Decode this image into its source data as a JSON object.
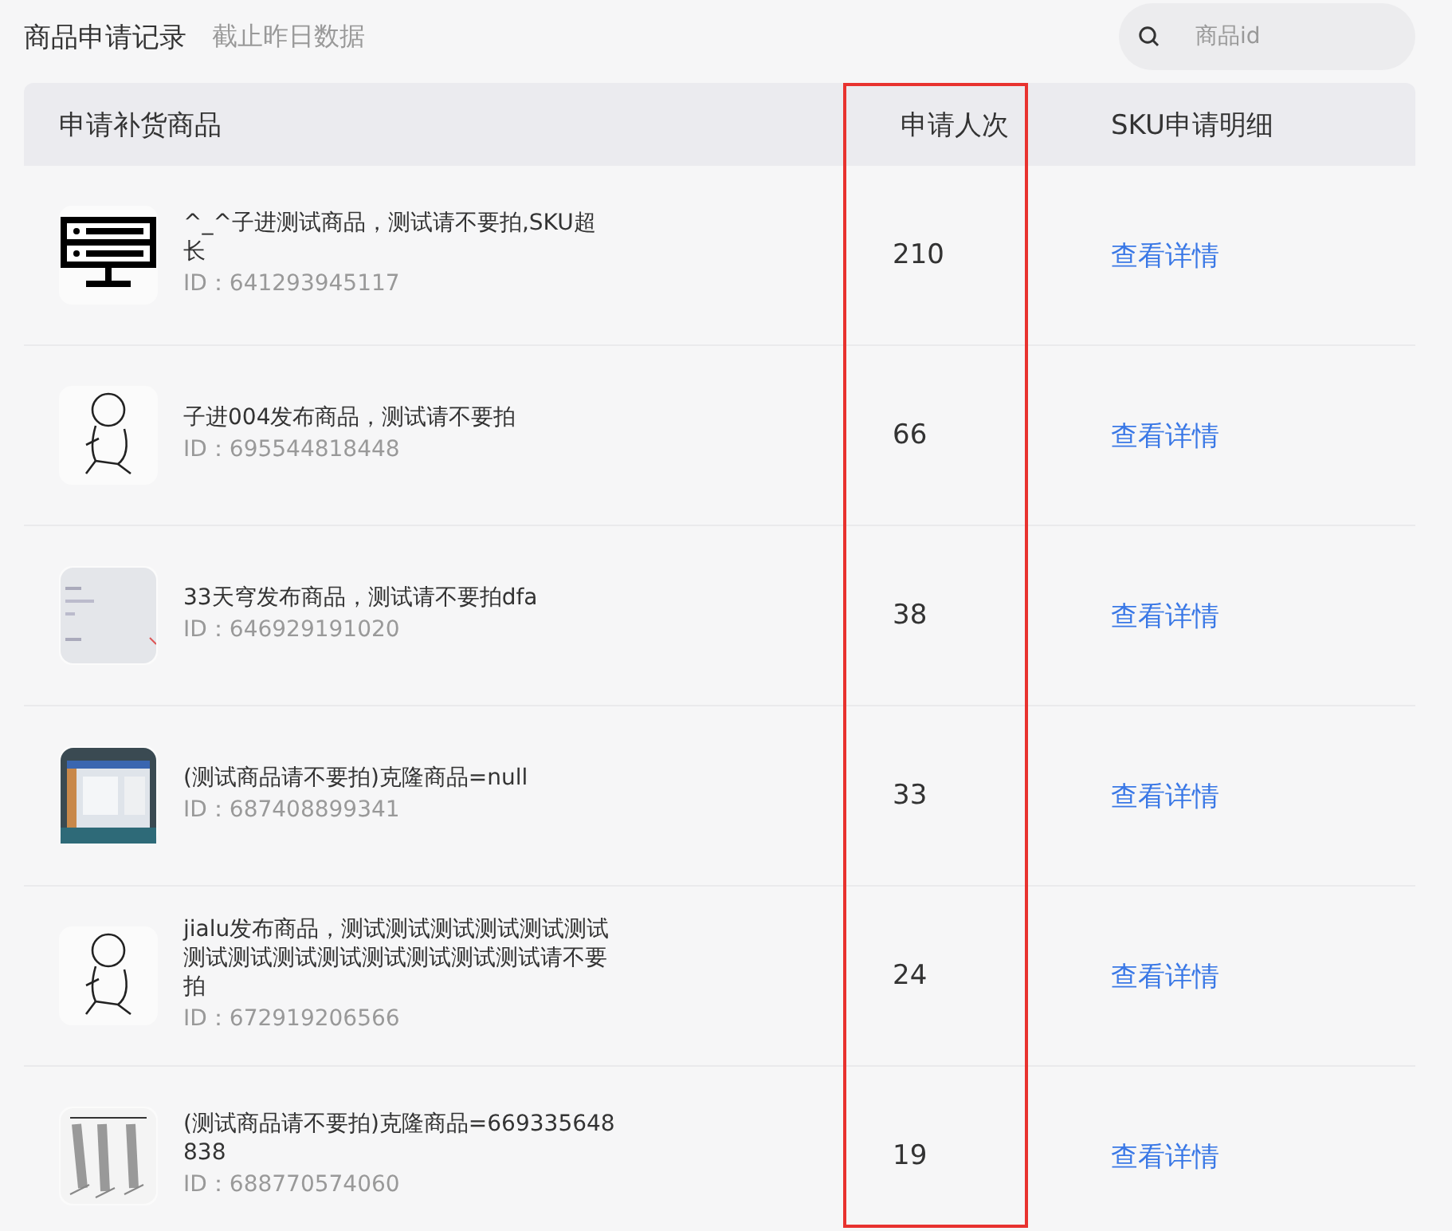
{
  "header": {
    "title": "商品申请记录",
    "subtitle": "截止昨日数据"
  },
  "search": {
    "placeholder": "商品id"
  },
  "table": {
    "columns": [
      {
        "label": "申请补货商品",
        "highlighted": false
      },
      {
        "label": "申请人次",
        "highlighted": true
      },
      {
        "label": "SKU申请明细",
        "highlighted": false
      }
    ],
    "rows": [
      {
        "thumbnail": {
          "kind": "server"
        },
        "name": "^_^子进测试商品，测试请不要拍,SKU超长",
        "id": "ID：641293945117",
        "count": "210",
        "link": "查看详情"
      },
      {
        "thumbnail": {
          "kind": "figure"
        },
        "name": "子进004发布商品，测试请不要拍",
        "id": "ID：695544818448",
        "count": "66",
        "link": "查看详情"
      },
      {
        "thumbnail": {
          "kind": "doc"
        },
        "name": "33天穹发布商品，测试请不要拍dfa",
        "id": "ID：646929191020",
        "count": "38",
        "link": "查看详情"
      },
      {
        "name": "(测试商品请不要拍)克隆商品=null",
        "id": "ID：687408899341",
        "count": "33",
        "link": "查看详情"
      },
      {
        "thumbnail": {
          "kind": "figure"
        },
        "name": "jialu发布商品，测试测试测试测试测试测试测试测试测试测试测试测试测试测试请不要拍",
        "id": "ID：672919206566",
        "count": "24",
        "link": "查看详情"
      },
      {
        "thumbnail": {
          "kind": "sketch"
        },
        "name": "(测试商品请不要拍)克隆商品=669335648838",
        "id": "ID：688770574060",
        "count": "19",
        "link": "查看详情"
      }
    ]
  }
}
